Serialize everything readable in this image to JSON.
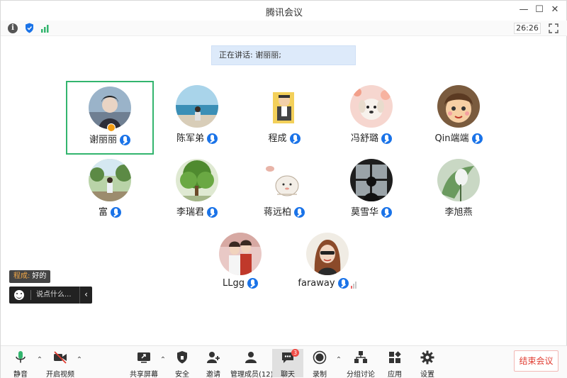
{
  "window": {
    "title": "腾讯会议",
    "minimize": "—",
    "maximize": "☐",
    "close": "✕"
  },
  "infobar": {
    "timer": "26:26"
  },
  "speaking": {
    "text": "正在讲话: 谢丽丽;"
  },
  "participants": [
    {
      "name": "谢丽丽",
      "mic": true,
      "active": true,
      "host": true
    },
    {
      "name": "陈军弟",
      "mic": true
    },
    {
      "name": "程成",
      "mic": true
    },
    {
      "name": "冯舒璐",
      "mic": true
    },
    {
      "name": "Qin端端",
      "mic": true
    },
    {
      "name": "富",
      "mic": true
    },
    {
      "name": "李瑞君",
      "mic": true
    },
    {
      "name": "蒋远柏",
      "mic": true
    },
    {
      "name": "莫雪华",
      "mic": true
    },
    {
      "name": "李旭燕",
      "mic": false
    },
    {
      "name": "LLgg",
      "mic": true
    },
    {
      "name": "faraway",
      "mic": true,
      "volume": true
    }
  ],
  "chat": {
    "sender": "程成:",
    "message": "好的",
    "placeholder": "说点什么...",
    "collapse": "‹"
  },
  "toolbar": {
    "mute": "静音",
    "video": "开启视频",
    "share": "共享屏幕",
    "security": "安全",
    "invite": "邀请",
    "members": "管理成员(12)",
    "chat": "聊天",
    "chat_badge": "3",
    "record": "录制",
    "breakout": "分组讨论",
    "apps": "应用",
    "settings": "设置",
    "end": "结束会议"
  },
  "colors": {
    "accent": "#1a73e8",
    "active_border": "#33b56e",
    "end": "#e03c31",
    "banner": "#ddeafa"
  }
}
